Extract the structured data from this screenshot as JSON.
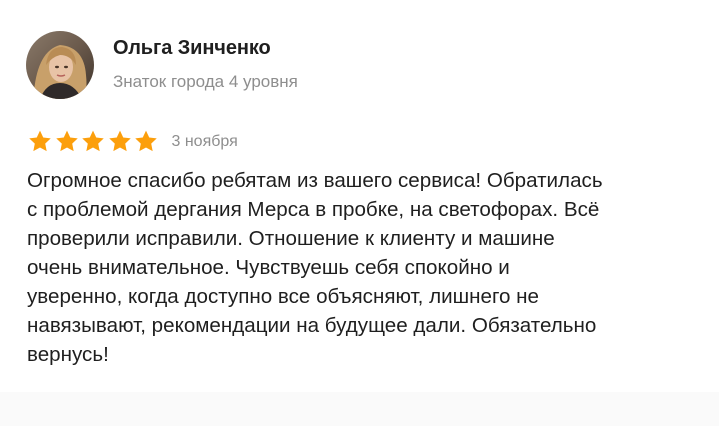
{
  "author": {
    "name": "Ольга Зинченко",
    "level": "Знаток города 4 уровня",
    "avatar_icon": "user-photo"
  },
  "rating": {
    "value": 5,
    "max": 5,
    "star_color": "#fc9f0c",
    "star_icon": "star-icon"
  },
  "review": {
    "date": "3 ноября",
    "lines": [
      "Огромное спасибо ребятам из вашего сервиса! Обратилась",
      "с проблемой дергания Мерса в пробке, на светофорах. Всё",
      "проверили исправили. Отношение к клиенту и машине",
      "очень внимательное. Чувствуешь себя спокойно и",
      "уверенно, когда доступно все объясняют, лишнего не",
      "навязывают, рекомендации на будущее дали. Обязательно",
      "вернусь!"
    ]
  }
}
